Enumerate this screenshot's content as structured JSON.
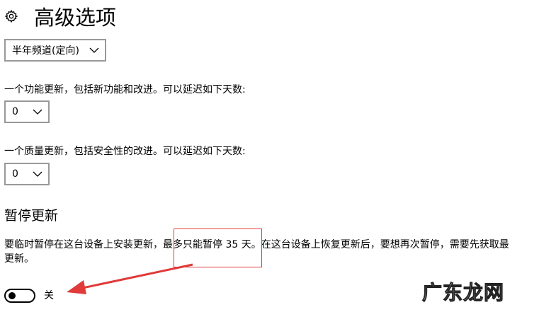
{
  "header": {
    "title": "高级选项",
    "icon": "gear-icon"
  },
  "branch": {
    "selected": "半年频道(定向)"
  },
  "feature_updates": {
    "label": "一个功能更新，包括新功能和改进。可以延迟如下天数:",
    "selected": "0"
  },
  "quality_updates": {
    "label": "一个质量更新，包括安全性的改进。可以延迟如下天数:",
    "selected": "0"
  },
  "pause": {
    "title": "暂停更新",
    "desc_line1": "要临时暂停在这台设备上安装更新，最多只能暂停 35 天。在这台设备上恢复更新后，要想再次暂停，需要先获取最",
    "desc_line2": "更新。",
    "toggle_state": "关"
  },
  "watermark": {
    "text": "广东龙网"
  },
  "colors": {
    "annotation_red": "#e03a3a",
    "border_gray": "#999999"
  }
}
